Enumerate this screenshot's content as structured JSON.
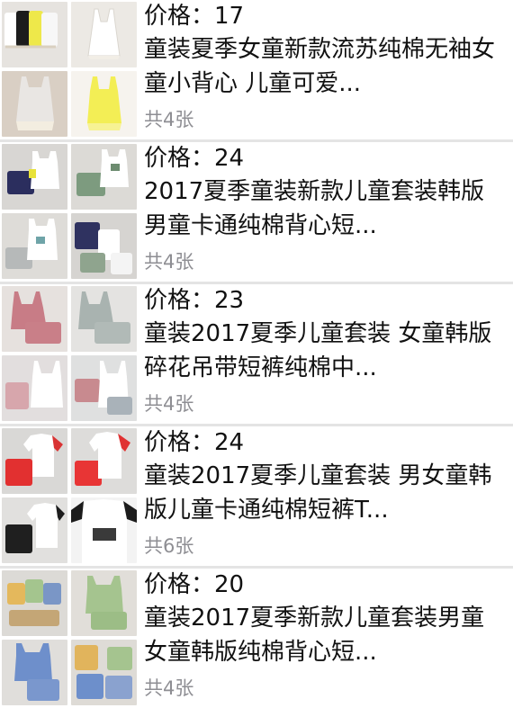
{
  "items": [
    {
      "price_label": "价格：17",
      "title": "童装夏季女童新款流苏纯棉无袖女童小背心 儿童可爱...",
      "count": "共4张",
      "colors": [
        "#f2f2f2",
        "#e8e5e0",
        "#f4f0e6",
        "#f0ee8a"
      ]
    },
    {
      "price_label": "价格：24",
      "title": "2017夏季童装新款儿童套装韩版男童卡通纯棉背心短...",
      "count": "共4张",
      "colors": [
        "#2c2f5e",
        "#7e9a7e",
        "#b9bcbc",
        "#34375f"
      ]
    },
    {
      "price_label": "价格：23",
      "title": "童装2017夏季儿童套装 女童韩版碎花吊带短裤纯棉中...",
      "count": "共4张",
      "colors": [
        "#c77f86",
        "#a7b0ad",
        "#d4a9ae",
        "#a9b2b7"
      ]
    },
    {
      "price_label": "价格：24",
      "title": "童装2017夏季儿童套装 男女童韩版儿童卡通纯棉短裤T...",
      "count": "共6张",
      "colors": [
        "#d63232",
        "#e83434",
        "#1d1d1d",
        "#1e1e1e"
      ]
    },
    {
      "price_label": "价格：20",
      "title": "童装2017夏季新款儿童套装男童女童韩版纯棉背心短...",
      "count": "共4张",
      "colors": [
        "#e0b65a",
        "#a5c48f",
        "#6d8fcb",
        "#7b94c8"
      ]
    }
  ]
}
